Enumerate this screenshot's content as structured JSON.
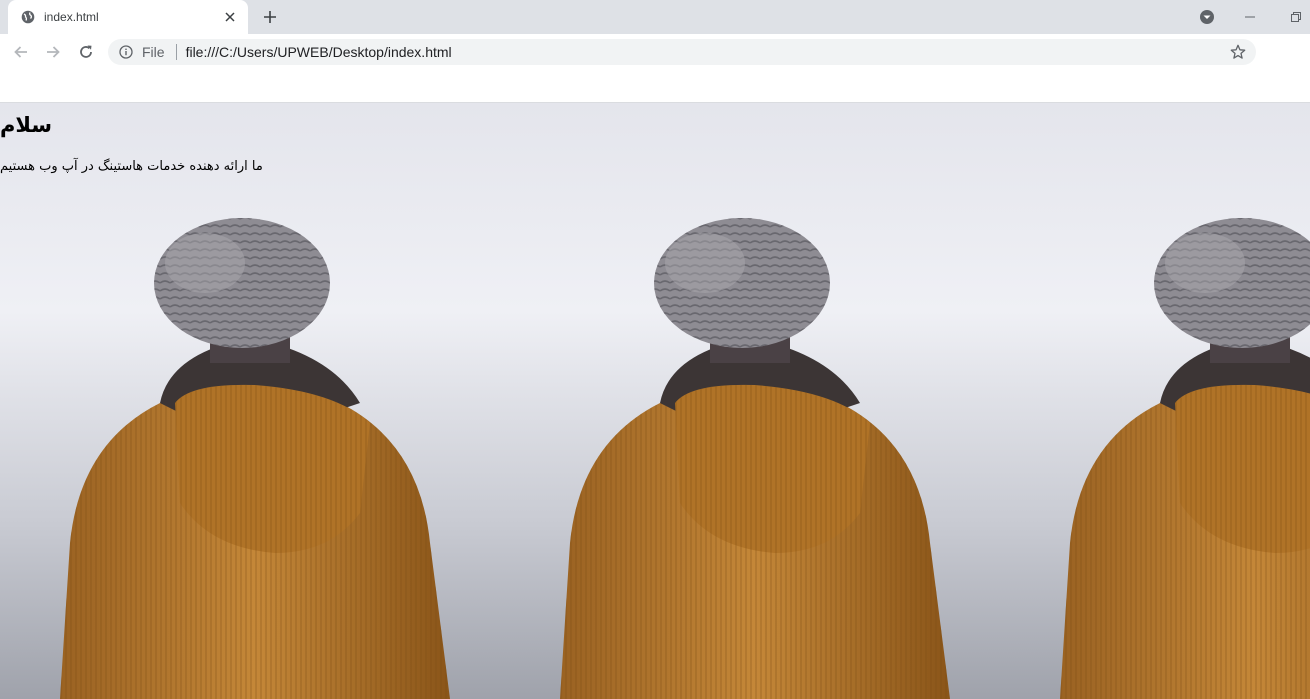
{
  "browser": {
    "tab": {
      "title": "index.html",
      "favicon": "globe-icon"
    },
    "newtab_icon": "plus-icon",
    "window_controls": [
      "minimize-icon",
      "restore-icon"
    ],
    "nav": {
      "back": "arrow-left-icon",
      "forward": "arrow-right-icon",
      "reload": "reload-icon"
    },
    "omnibox": {
      "scheme_chip": "File",
      "url": "file:///C:/Users/UPWEB/Desktop/index.html",
      "info_icon": "info-icon",
      "bookmark_icon": "star-icon"
    }
  },
  "page": {
    "heading": "سلام",
    "paragraph": "ما ارائه دهنده خدمات هاستینگ در آپ وب هستیم",
    "background": {
      "description_icon": "person-in-beanie-jacket-image",
      "tile_count": 3
    }
  },
  "colors": {
    "tabstrip": "#dee1e6",
    "omnibox": "#f1f3f4",
    "jacket": "#b97a2e",
    "beanie": "#8e8c93",
    "sky": "#e8e9ef"
  }
}
